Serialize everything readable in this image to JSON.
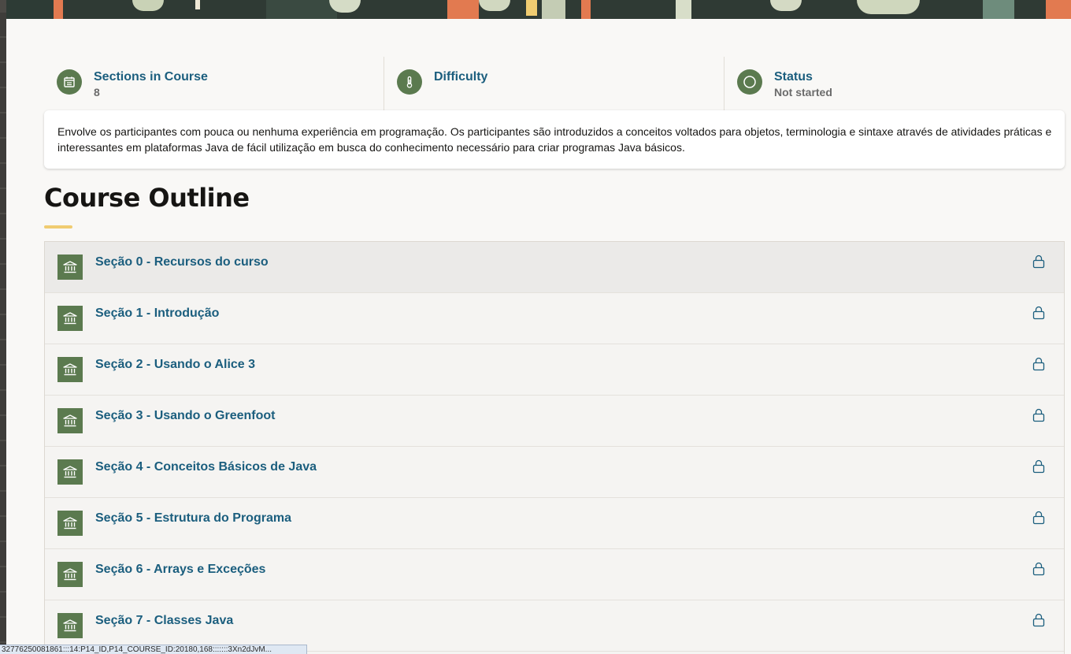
{
  "stats": [
    {
      "icon": "calendar-icon",
      "title": "Sections in Course",
      "value": "8"
    },
    {
      "icon": "thermometer-icon",
      "title": "Difficulty",
      "value": ""
    },
    {
      "icon": "status-circle-icon",
      "title": "Status",
      "value": "Not started"
    }
  ],
  "description": "Envolve os participantes com pouca ou nenhuma experiência em programação. Os participantes são introduzidos a conceitos voltados para objetos, terminologia e sintaxe através de atividades práticas e interessantes em plataformas Java de fácil utilização em busca do conhecimento necessário para criar programas Java básicos.",
  "outline": {
    "title": "Course Outline",
    "sections": [
      {
        "label": "Seção 0 - Recursos do curso",
        "icon": "institution-icon",
        "locked": true
      },
      {
        "label": "Seção 1 - Introdução",
        "icon": "institution-icon",
        "locked": true
      },
      {
        "label": "Seção 2 - Usando o Alice 3",
        "icon": "institution-icon",
        "locked": true
      },
      {
        "label": "Seção 3 - Usando o Greenfoot",
        "icon": "institution-icon",
        "locked": true
      },
      {
        "label": "Seção 4 - Conceitos Básicos de Java",
        "icon": "institution-icon",
        "locked": true
      },
      {
        "label": "Seção 5 - Estrutura do Programa",
        "icon": "institution-icon",
        "locked": true
      },
      {
        "label": "Seção 6 - Arrays e Exceções",
        "icon": "institution-icon",
        "locked": true
      },
      {
        "label": "Seção 7 - Classes Java",
        "icon": "institution-icon",
        "locked": true
      }
    ]
  },
  "status_bar": {
    "text": "32776250081861:::14:P14_ID,P14_COURSE_ID:20180,168:::::::3Xn2dJvM..."
  },
  "colors": {
    "accent": "#5b7a4f",
    "link": "#1b5e7e",
    "underline": "#f0cc71"
  }
}
